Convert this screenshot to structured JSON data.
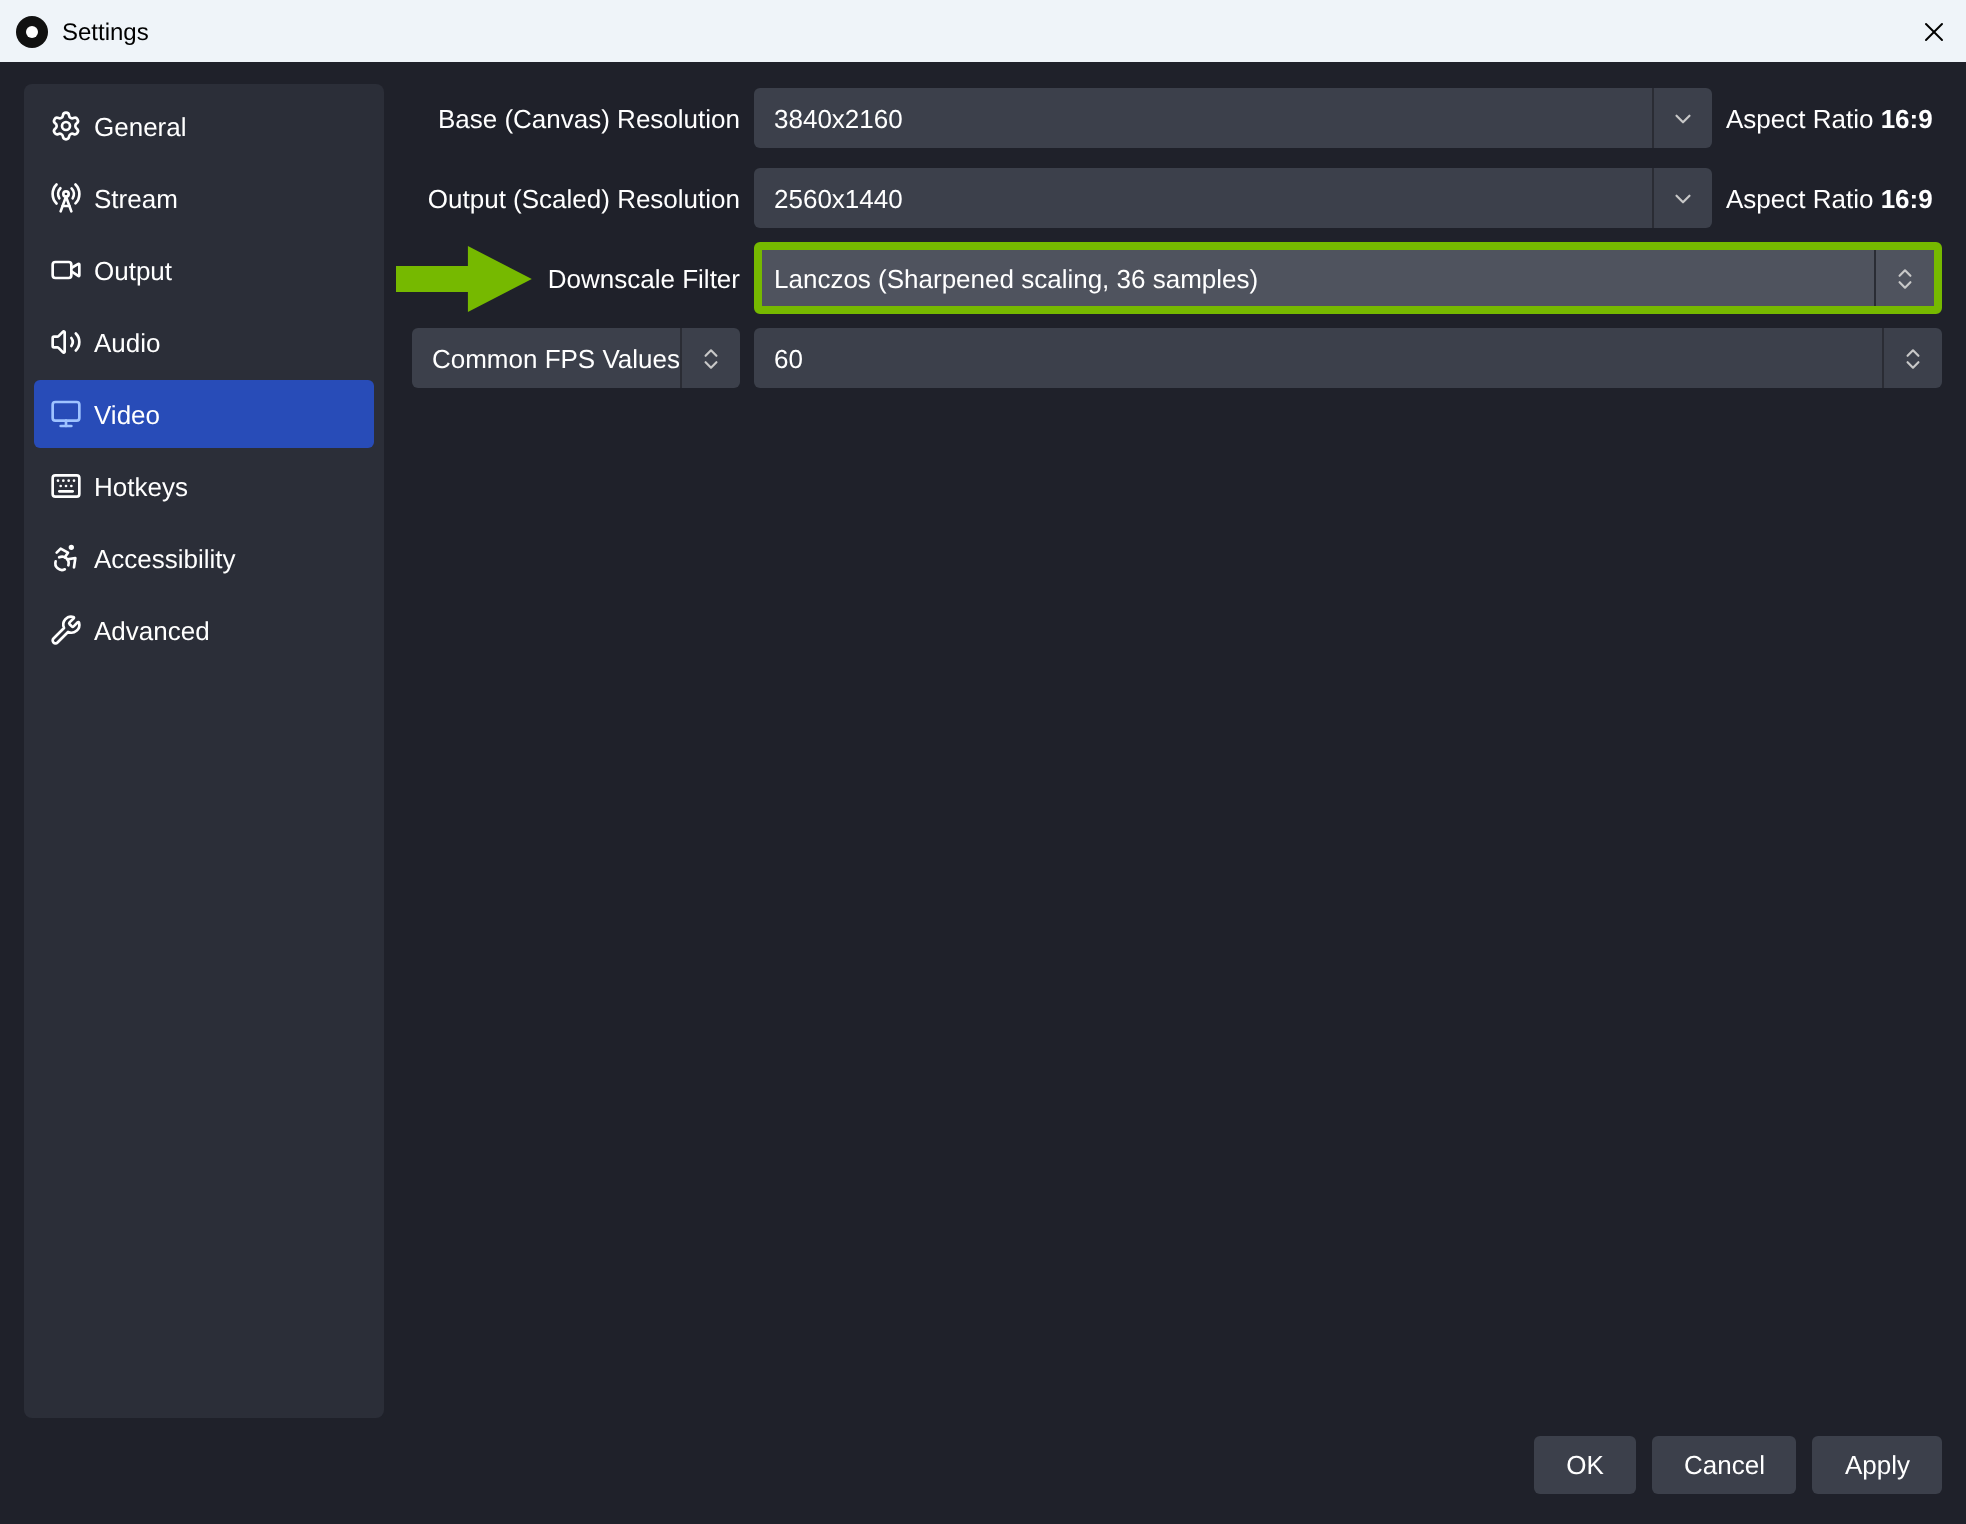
{
  "window": {
    "title": "Settings"
  },
  "sidebar": {
    "items": [
      {
        "label": "General",
        "selected": false
      },
      {
        "label": "Stream",
        "selected": false
      },
      {
        "label": "Output",
        "selected": false
      },
      {
        "label": "Audio",
        "selected": false
      },
      {
        "label": "Video",
        "selected": true
      },
      {
        "label": "Hotkeys",
        "selected": false
      },
      {
        "label": "Accessibility",
        "selected": false
      },
      {
        "label": "Advanced",
        "selected": false
      }
    ]
  },
  "settings": [
    {
      "kind": "dropdown",
      "label": "Base (Canvas) Resolution",
      "value": "3840x2160",
      "aspect": "Aspect Ratio **16:9**",
      "highlighted": false
    },
    {
      "kind": "dropdown",
      "label": "Output (Scaled) Resolution",
      "value": "2560x1440",
      "aspect": "Aspect Ratio **16:9**",
      "highlighted": false
    },
    {
      "kind": "select",
      "label": "Downscale Filter",
      "value": "Lanczos (Sharpened scaling, 36 samples)",
      "highlighted": true
    },
    {
      "kind": "fps",
      "label": "Common FPS Values",
      "value": "60",
      "highlighted": false
    }
  ],
  "buttons": [
    "OK",
    "Cancel",
    "Apply"
  ]
}
